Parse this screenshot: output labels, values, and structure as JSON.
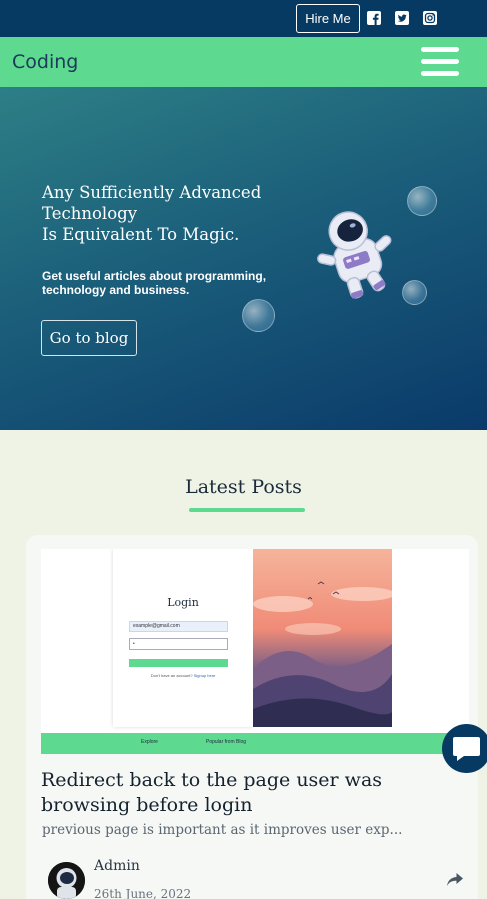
{
  "topbar": {
    "hire_label": "Hire Me",
    "social": [
      "facebook-icon",
      "twitter-icon",
      "instagram-icon"
    ]
  },
  "nav": {
    "brand": "Coding",
    "menu_icon": "hamburger-icon"
  },
  "hero": {
    "title_lines": [
      "Any Sufficiently Advanced",
      "Technology",
      "Is Equivalent To Magic."
    ],
    "subtitle": "Get useful articles about programming, technology and business.",
    "cta_label": "Go to blog"
  },
  "latest": {
    "heading": "Latest Posts"
  },
  "post": {
    "thumbnail": {
      "login_title": "Login",
      "email_value": "example@gmail.com",
      "password_value": "•",
      "signup_prompt": "Don't have an account?",
      "signup_link": "Signup here",
      "footer_items": [
        "Explore",
        "Popular from Blog"
      ]
    },
    "title": "Redirect back to the page user was browsing before login",
    "excerpt": "previous page is important as it improves user exp...",
    "author": "Admin",
    "date": "26th June, 2022"
  },
  "colors": {
    "navy": "#073a63",
    "accent_green": "#5dd990",
    "page_bg": "#eef3e6"
  }
}
